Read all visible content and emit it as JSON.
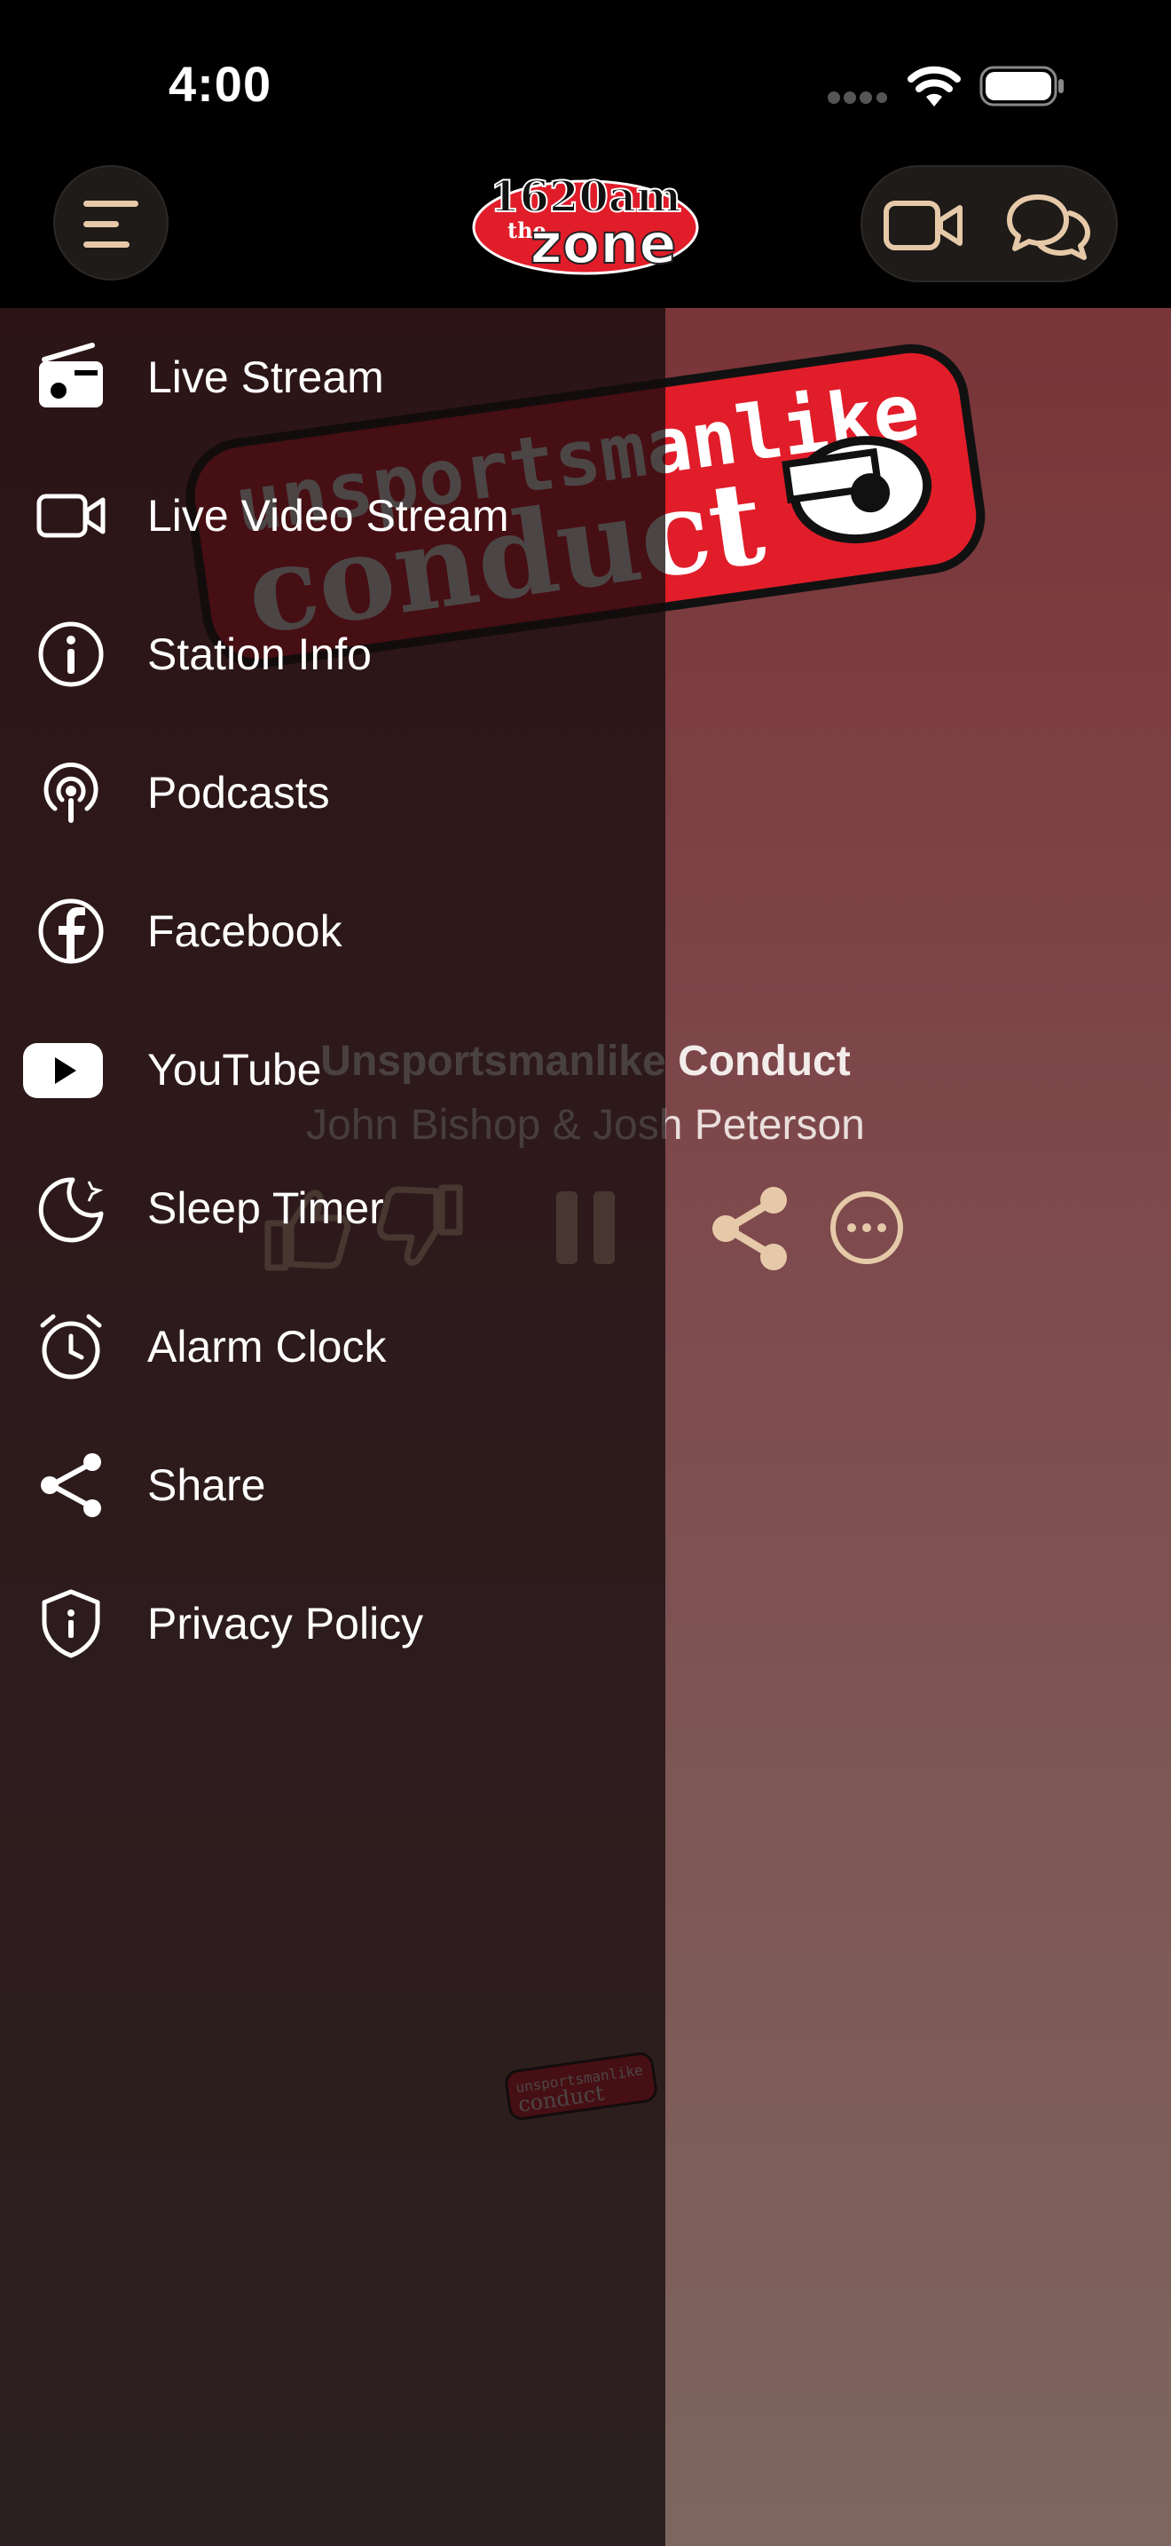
{
  "status_bar": {
    "time": "4:00"
  },
  "header": {
    "logo_text_top": "1620am",
    "logo_text_the": "the",
    "logo_text_main": "zone"
  },
  "player": {
    "title": "Unsportsmanlike Conduct",
    "artist": "John Bishop & Josh Peterson",
    "cover_text_line1": "unsportsmanlike",
    "cover_text_line2": "conduct"
  },
  "drawer": {
    "items": [
      {
        "label": "Live Stream",
        "icon": "radio-icon"
      },
      {
        "label": "Live Video Stream",
        "icon": "video-camera-icon"
      },
      {
        "label": "Station Info",
        "icon": "info-icon"
      },
      {
        "label": "Podcasts",
        "icon": "podcast-icon"
      },
      {
        "label": "Facebook",
        "icon": "facebook-icon"
      },
      {
        "label": "YouTube",
        "icon": "youtube-icon"
      },
      {
        "label": "Sleep Timer",
        "icon": "moon-icon"
      },
      {
        "label": "Alarm Clock",
        "icon": "alarm-clock-icon"
      },
      {
        "label": "Share",
        "icon": "share-icon"
      },
      {
        "label": "Privacy Policy",
        "icon": "shield-icon"
      }
    ]
  },
  "colors": {
    "accent": "#e6c9a8",
    "logo_red": "#e11d2a",
    "drawer_bg": "#1f1012"
  }
}
